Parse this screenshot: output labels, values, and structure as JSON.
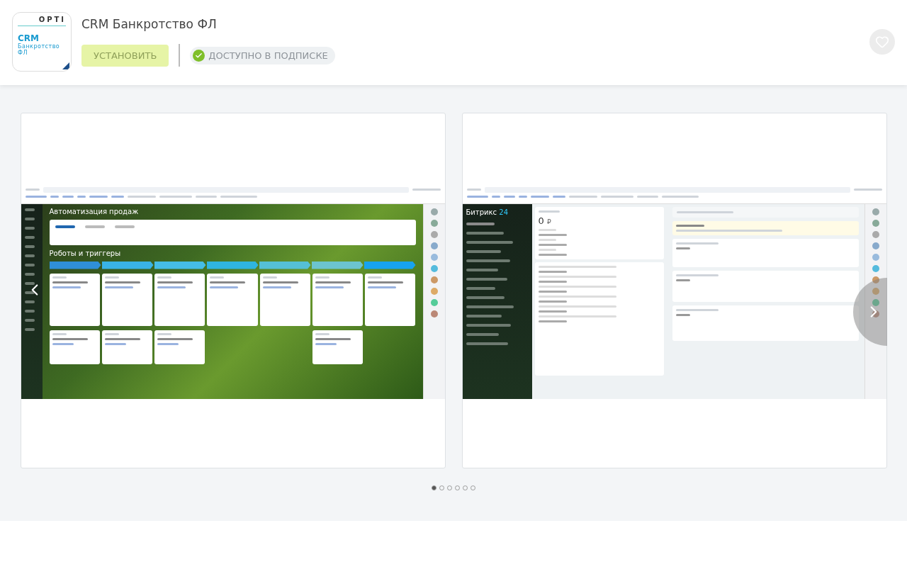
{
  "app": {
    "logo": {
      "brand": "OPTI",
      "line1": "CRM",
      "line2": "Банкротство",
      "line3": "ФЛ"
    },
    "title": "CRM Банкротство ФЛ",
    "install_button": {
      "label": "УСТАНОВИТЬ",
      "disabled": true
    },
    "subscription_badge": "ДОСТУПНО В ПОДПИСКЕ",
    "favorite": false
  },
  "gallery": {
    "slides": [
      {
        "kind": "automation",
        "title": "Автоматизация продаж",
        "heading": "Роботы и триггеры",
        "tabs": [
          {
            "selected": true
          },
          {
            "selected": false
          },
          {
            "selected": false
          }
        ],
        "stages": [
          {
            "color": "#2f8fd8"
          },
          {
            "color": "#39b3e6"
          },
          {
            "color": "#45bde6"
          },
          {
            "color": "#2fb5e0"
          },
          {
            "color": "#55c0d6"
          },
          {
            "color": "#6cc4cf"
          },
          {
            "color": "#17a3ef"
          }
        ]
      },
      {
        "kind": "lead_details",
        "logo": "Битрикс",
        "logo_num": "24",
        "amount": "0",
        "currency": "₽",
        "menu": [
          {
            "selected": true
          },
          {
            "selected": false
          },
          {
            "selected": false
          },
          {
            "selected": false
          },
          {
            "selected": false
          },
          {
            "selected": false
          },
          {
            "selected": false
          },
          {
            "selected": false
          },
          {
            "selected": false
          },
          {
            "selected": false
          },
          {
            "selected": false
          },
          {
            "selected": false
          },
          {
            "selected": false
          },
          {
            "selected": false
          }
        ]
      }
    ],
    "dots": [
      {
        "selected": true
      },
      {
        "selected": false
      },
      {
        "selected": false
      },
      {
        "selected": false
      },
      {
        "selected": false
      },
      {
        "selected": false
      }
    ]
  }
}
